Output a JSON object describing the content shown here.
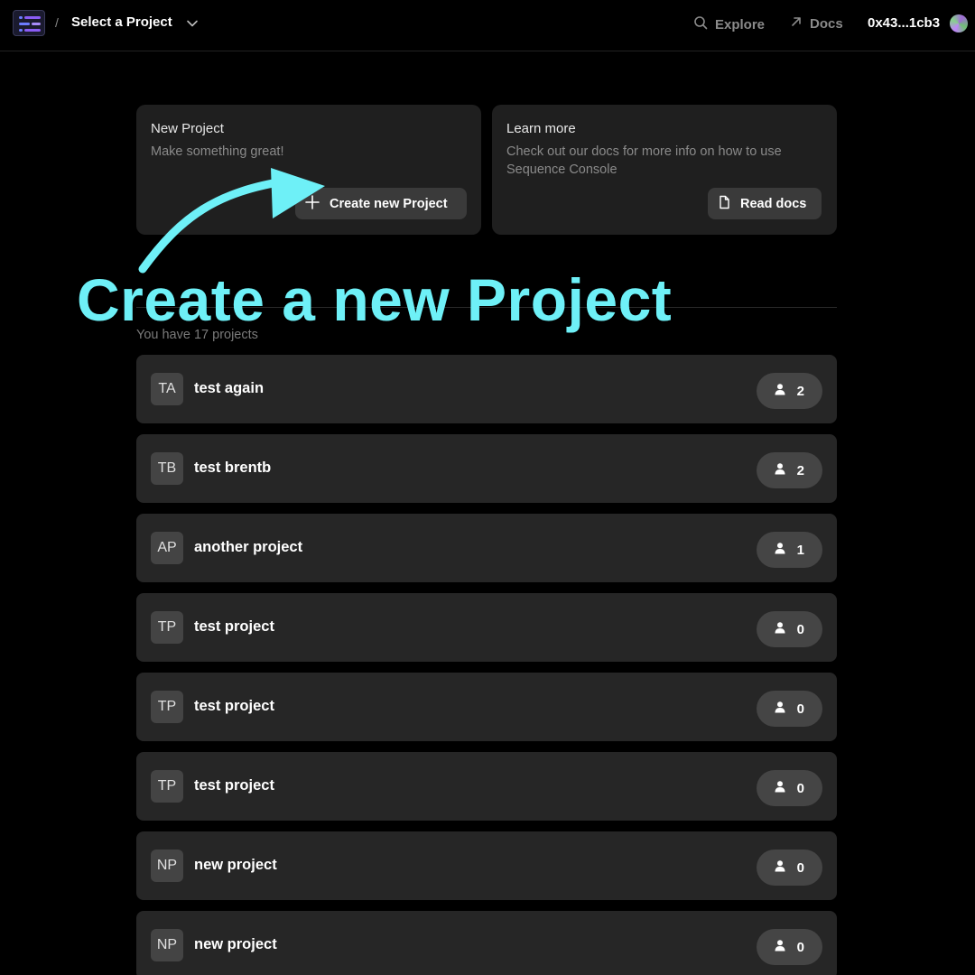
{
  "header": {
    "separator": "/",
    "project_select": "Select a Project",
    "explore": "Explore",
    "docs": "Docs",
    "wallet": "0x43...1cb3"
  },
  "cards": {
    "new_project": {
      "title": "New Project",
      "subtitle": "Make something great!",
      "button": "Create new Project"
    },
    "learn_more": {
      "title": "Learn more",
      "subtitle": "Check out our docs for more info on how to use Sequence Console",
      "button": "Read docs"
    }
  },
  "project_count": "You have 17 projects",
  "projects": [
    {
      "initials": "TA",
      "name": "test again",
      "members": "2"
    },
    {
      "initials": "TB",
      "name": "test brentb",
      "members": "2"
    },
    {
      "initials": "AP",
      "name": "another project",
      "members": "1"
    },
    {
      "initials": "TP",
      "name": "test project",
      "members": "0"
    },
    {
      "initials": "TP",
      "name": "test project",
      "members": "0"
    },
    {
      "initials": "TP",
      "name": "test project",
      "members": "0"
    },
    {
      "initials": "NP",
      "name": "new project",
      "members": "0"
    },
    {
      "initials": "NP",
      "name": "new project",
      "members": "0"
    }
  ],
  "annotation": {
    "text": "Create a new Project",
    "color": "#6ef0f7"
  },
  "icons": {
    "logo": "sequence-logo-icon",
    "select": "chevron-down-icon",
    "explore": "search-icon",
    "docs": "arrow-up-right-icon",
    "create": "plus-icon",
    "read_docs": "document-icon",
    "members": "user-icon"
  }
}
